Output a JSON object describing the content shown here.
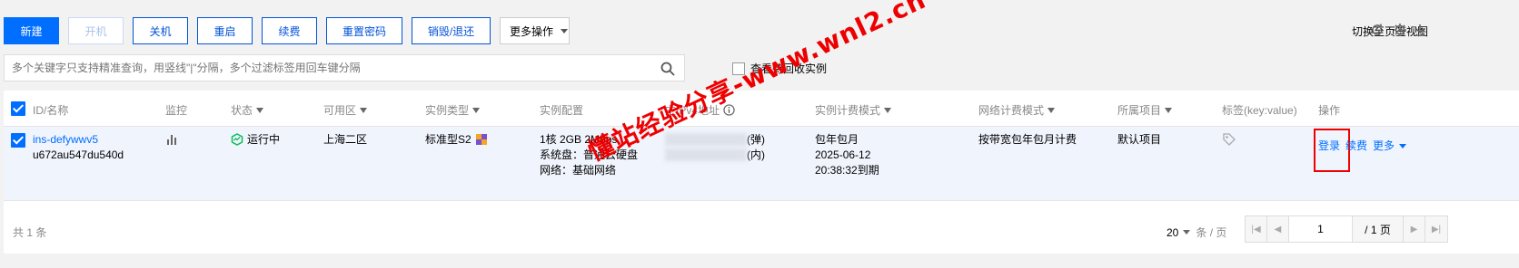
{
  "toolbar": {
    "new": "新建",
    "power_on": "开机",
    "power_off": "关机",
    "restart": "重启",
    "renew": "续费",
    "reset_password": "重置密码",
    "destroy_return": "销毁/退还",
    "more_actions": "更多操作",
    "switch_tab_view": "切换至页签视图"
  },
  "search": {
    "placeholder": "多个关键字只支持精准查询，用竖线\"|\"分隔，多个过滤标签用回车键分隔",
    "recycle_label": "查看待回收实例"
  },
  "table": {
    "headers": {
      "id_name": "ID/名称",
      "monitor": "监控",
      "status": "状态",
      "zone": "可用区",
      "instance_type": "实例类型",
      "config": "实例配置",
      "ipv4": "主IPv4地址",
      "billing_mode": "实例计费模式",
      "network_billing": "网络计费模式",
      "project": "所属项目",
      "tags": "标签(key:value)",
      "actions": "操作"
    },
    "rows": [
      {
        "id": "ins-defywwv5",
        "name": "u672au547du540d",
        "status": "运行中",
        "zone": "上海二区",
        "instance_type": "标准型S2",
        "config_line1": "1核 2GB 2Mbps",
        "config_line2": "系统盘：普通云硬盘",
        "config_line3": "网络：基础网络",
        "ip_public_suffix": "(弹)",
        "ip_private_suffix": "(内)",
        "billing_line1": "包年包月",
        "billing_line2": "2025-06-12",
        "billing_line3": "20:38:32到期",
        "network_billing": "按带宽包年包月计费",
        "project": "默认项目",
        "action_login": "登录",
        "action_renew": "续费",
        "action_more": "更多"
      }
    ]
  },
  "footer": {
    "total": "共 1 条",
    "page_size": "20",
    "page_size_unit": "条 / 页",
    "current_page": "1",
    "total_pages": "/ 1 页"
  },
  "watermark": "懂站经验分享-www.wnl2.cn",
  "colors": {
    "primary": "#006eff",
    "highlight_box": "#e00000",
    "row_selected": "#f0f4fd"
  }
}
